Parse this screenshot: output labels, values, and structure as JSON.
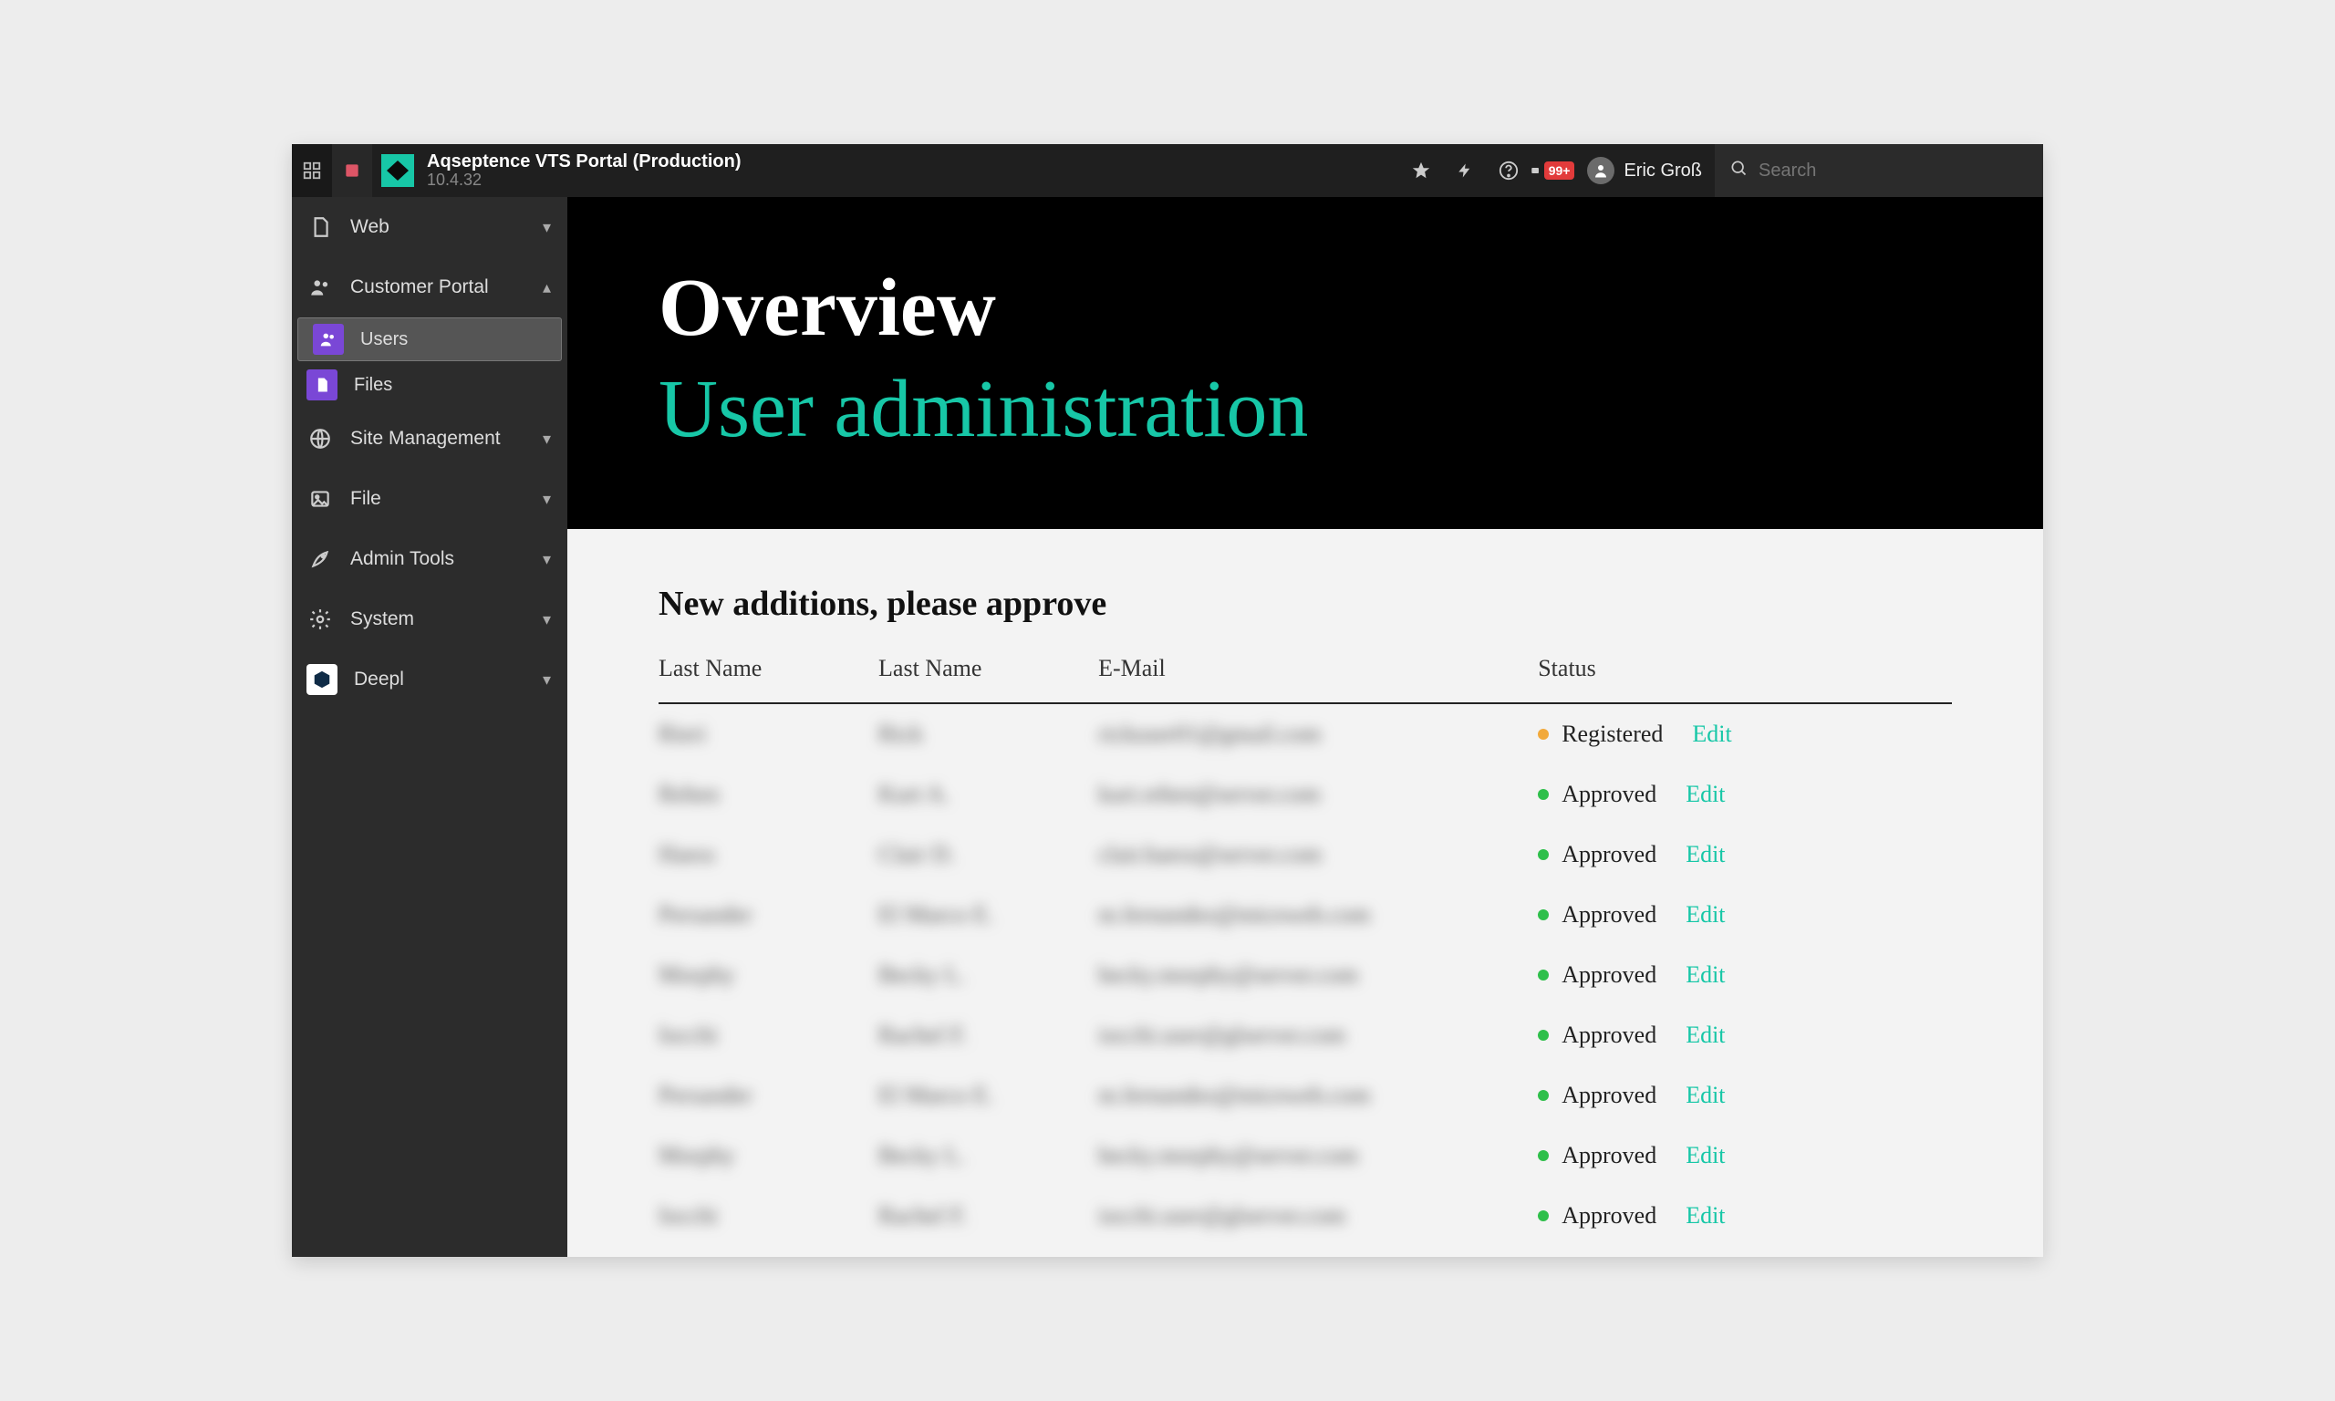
{
  "topbar": {
    "app_title": "Aqseptence VTS Portal (Production)",
    "app_version": "10.4.32",
    "badge_text": "99+",
    "user_name": "Eric Groß",
    "search_placeholder": "Search"
  },
  "sidebar": {
    "items": [
      {
        "label": "Web",
        "expanded": false
      },
      {
        "label": "Customer Portal",
        "expanded": true
      },
      {
        "label": "Site Management",
        "expanded": false
      },
      {
        "label": "File",
        "expanded": false
      },
      {
        "label": "Admin Tools",
        "expanded": false
      },
      {
        "label": "System",
        "expanded": false
      },
      {
        "label": "Deepl",
        "expanded": false
      }
    ],
    "customer_portal_children": [
      {
        "label": "Users",
        "active": true
      },
      {
        "label": "Files",
        "active": false
      }
    ]
  },
  "hero": {
    "title": "Overview",
    "subtitle": "User administration"
  },
  "section": {
    "title": "New additions, please approve"
  },
  "table": {
    "columns": [
      "Last Name",
      "Last Name",
      "E-Mail",
      "Status"
    ],
    "edit_label": "Edit",
    "rows": [
      {
        "last": "Rieri",
        "first": "Rick",
        "email": "rickuser01@gmail.com",
        "status": "Registered",
        "status_color": "amber"
      },
      {
        "last": "Rehen",
        "first": "Kurt A.",
        "email": "kurt.rehen@server.com",
        "status": "Approved",
        "status_color": "green"
      },
      {
        "last": "Haess",
        "first": "Clair D.",
        "email": "clair.haess@server.com",
        "status": "Approved",
        "status_color": "green"
      },
      {
        "last": "Persander",
        "first": "El Marco E.",
        "email": "m.fernandez@miceweb.com",
        "status": "Approved",
        "status_color": "green"
      },
      {
        "last": "Morphy",
        "first": "Becky L.",
        "email": "becky.morphy@server.com",
        "status": "Approved",
        "status_color": "green"
      },
      {
        "last": "Iocchi",
        "first": "Rachel F.",
        "email": "iocchi.user@glserver.com",
        "status": "Approved",
        "status_color": "green"
      },
      {
        "last": "Persander",
        "first": "El Marco E.",
        "email": "m.fernandez@miceweb.com",
        "status": "Approved",
        "status_color": "green"
      },
      {
        "last": "Morphy",
        "first": "Becky L.",
        "email": "becky.morphy@server.com",
        "status": "Approved",
        "status_color": "green"
      },
      {
        "last": "Iocchi",
        "first": "Rachel F.",
        "email": "iocchi.user@glserver.com",
        "status": "Approved",
        "status_color": "green"
      }
    ]
  }
}
